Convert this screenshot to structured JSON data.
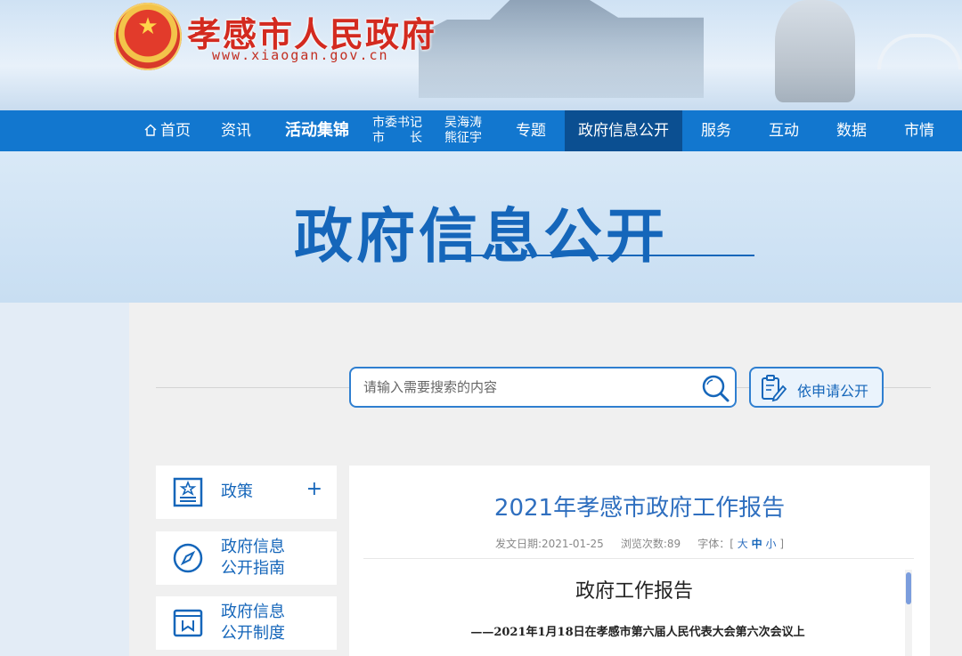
{
  "header": {
    "site_title": "孝感市人民政府",
    "site_url": "www.xiaogan.gov.cn"
  },
  "nav": {
    "items": [
      {
        "label": "首页",
        "icon": "home-icon"
      },
      {
        "label": "资讯"
      },
      {
        "label": "活动集锦"
      },
      {
        "label_line1": "市委书记",
        "label_line2": "市　　长"
      },
      {
        "label_line1": "吴海涛",
        "label_line2": "熊征宇"
      },
      {
        "label": "专题"
      },
      {
        "label": "政府信息公开",
        "active": true
      },
      {
        "label": "服务"
      },
      {
        "label": "互动"
      },
      {
        "label": "数据"
      },
      {
        "label": "市情"
      }
    ]
  },
  "hero": {
    "title": "政府信息公开"
  },
  "search": {
    "placeholder": "请输入需要搜索的内容",
    "icon": "search-icon"
  },
  "apply_button": {
    "label": "依申请公开",
    "icon": "clipboard-edit-icon"
  },
  "sidebar": {
    "items": [
      {
        "label": "政策",
        "icon": "policy-icon",
        "expand": "+"
      },
      {
        "label_line1": "政府信息",
        "label_line2": "公开指南",
        "icon": "compass-icon"
      },
      {
        "label_line1": "政府信息",
        "label_line2": "公开制度",
        "icon": "book-icon"
      }
    ]
  },
  "article": {
    "title": "2021年孝感市政府工作报告",
    "date_label": "发文日期:",
    "date": "2021-01-25",
    "views_label": "浏览次数:",
    "views": "89",
    "font_label": "字体：[",
    "font_large": "大",
    "font_medium": "中",
    "font_small": "小",
    "font_close": "]",
    "heading": "政府工作报告",
    "subheading": "——2021年1月18日在孝感市第六届人民代表大会第六次会议上"
  },
  "colors": {
    "nav_bg": "#1277cf",
    "nav_active": "#0b4f91",
    "accent": "#1566ba",
    "title_red": "#d32a1f"
  }
}
